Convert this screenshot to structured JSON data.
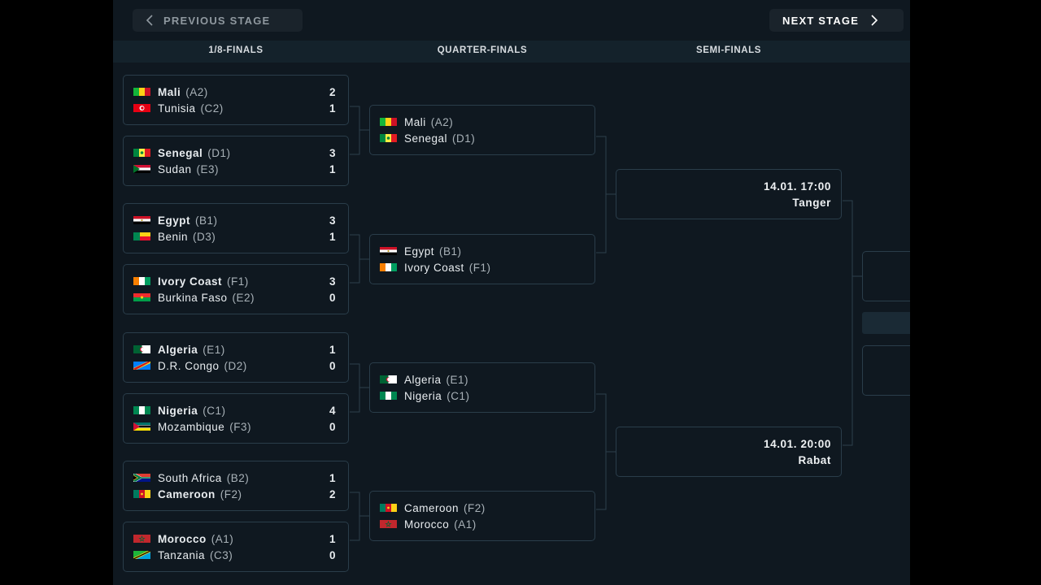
{
  "navigation": {
    "previous_stage": "PREVIOUS STAGE",
    "next_stage": "NEXT STAGE"
  },
  "tabs": [
    "1/8-FINALS",
    "QUARTER-FINALS",
    "SEMI-FINALS"
  ],
  "round_of_16": [
    {
      "home": {
        "name": "Mali",
        "group": "(A2)",
        "score": "2",
        "flag": "mali",
        "winner": true
      },
      "away": {
        "name": "Tunisia",
        "group": "(C2)",
        "score": "1",
        "flag": "tunisia",
        "winner": false
      }
    },
    {
      "home": {
        "name": "Senegal",
        "group": "(D1)",
        "score": "3",
        "flag": "senegal",
        "winner": true
      },
      "away": {
        "name": "Sudan",
        "group": "(E3)",
        "score": "1",
        "flag": "sudan",
        "winner": false
      }
    },
    {
      "home": {
        "name": "Egypt",
        "group": "(B1)",
        "score": "3",
        "flag": "egypt",
        "winner": true
      },
      "away": {
        "name": "Benin",
        "group": "(D3)",
        "score": "1",
        "flag": "benin",
        "winner": false
      }
    },
    {
      "home": {
        "name": "Ivory Coast",
        "group": "(F1)",
        "score": "3",
        "flag": "ivory-coast",
        "winner": true
      },
      "away": {
        "name": "Burkina Faso",
        "group": "(E2)",
        "score": "0",
        "flag": "burkina-faso",
        "winner": false
      }
    },
    {
      "home": {
        "name": "Algeria",
        "group": "(E1)",
        "score": "1",
        "flag": "algeria",
        "winner": true
      },
      "away": {
        "name": "D.R. Congo",
        "group": "(D2)",
        "score": "0",
        "flag": "dr-congo",
        "winner": false
      }
    },
    {
      "home": {
        "name": "Nigeria",
        "group": "(C1)",
        "score": "4",
        "flag": "nigeria",
        "winner": true
      },
      "away": {
        "name": "Mozambique",
        "group": "(F3)",
        "score": "0",
        "flag": "mozambique",
        "winner": false
      }
    },
    {
      "home": {
        "name": "South Africa",
        "group": "(B2)",
        "score": "1",
        "flag": "south-africa",
        "winner": false
      },
      "away": {
        "name": "Cameroon",
        "group": "(F2)",
        "score": "2",
        "flag": "cameroon",
        "winner": true
      }
    },
    {
      "home": {
        "name": "Morocco",
        "group": "(A1)",
        "score": "1",
        "flag": "morocco",
        "winner": true
      },
      "away": {
        "name": "Tanzania",
        "group": "(C3)",
        "score": "0",
        "flag": "tanzania",
        "winner": false
      }
    }
  ],
  "quarter_finals": [
    {
      "home": {
        "name": "Mali",
        "group": "(A2)",
        "flag": "mali"
      },
      "away": {
        "name": "Senegal",
        "group": "(D1)",
        "flag": "senegal"
      }
    },
    {
      "home": {
        "name": "Egypt",
        "group": "(B1)",
        "flag": "egypt"
      },
      "away": {
        "name": "Ivory Coast",
        "group": "(F1)",
        "flag": "ivory-coast"
      }
    },
    {
      "home": {
        "name": "Algeria",
        "group": "(E1)",
        "flag": "algeria"
      },
      "away": {
        "name": "Nigeria",
        "group": "(C1)",
        "flag": "nigeria"
      }
    },
    {
      "home": {
        "name": "Cameroon",
        "group": "(F2)",
        "flag": "cameroon"
      },
      "away": {
        "name": "Morocco",
        "group": "(A1)",
        "flag": "morocco"
      }
    }
  ],
  "semi_finals": [
    {
      "date": "14.01. 17:00",
      "venue": "Tanger"
    },
    {
      "date": "14.01. 20:00",
      "venue": "Rabat"
    }
  ],
  "colors": {
    "background": "#0f1820",
    "card_border": "#2a3d4a",
    "header_bar": "#14222b",
    "button": "#1a232b",
    "text": "#e8ecef",
    "muted_text": "#a9b2b8"
  }
}
